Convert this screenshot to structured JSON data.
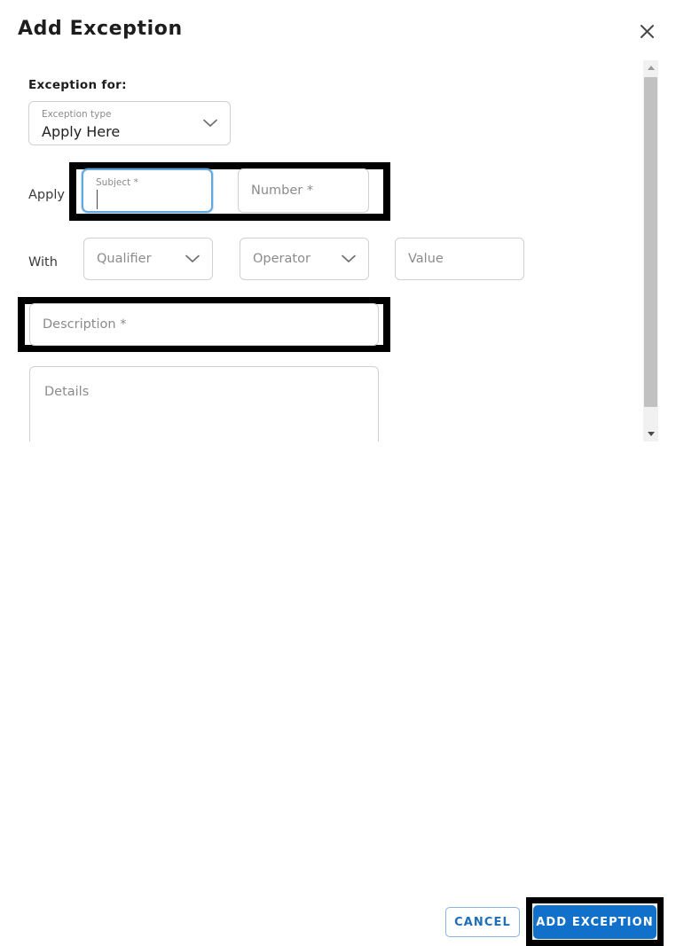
{
  "dialog": {
    "title": "Add Exception",
    "close_icon": "close-icon"
  },
  "body": {
    "section_label": "Exception for:",
    "exception_type": {
      "label": "Exception type",
      "value": "Apply Here",
      "chevron_icon": "chevron-down-icon"
    },
    "apply_row": {
      "label": "Apply",
      "subject": {
        "label": "Subject *",
        "value": "",
        "focused": true
      },
      "number": {
        "placeholder": "Number *",
        "value": ""
      }
    },
    "with_row": {
      "label": "With",
      "qualifier": {
        "placeholder": "Qualifier",
        "value": "",
        "chevron_icon": "chevron-down-icon"
      },
      "operator": {
        "placeholder": "Operator",
        "value": "",
        "chevron_icon": "chevron-down-icon"
      },
      "value_field": {
        "placeholder": "Value",
        "value": ""
      }
    },
    "description": {
      "placeholder": "Description *",
      "value": ""
    },
    "details": {
      "placeholder": "Details",
      "value": ""
    }
  },
  "scrollbar": {
    "up_icon": "scroll-up-arrow-icon",
    "down_icon": "scroll-down-arrow-icon"
  },
  "footer": {
    "cancel_label": "CANCEL",
    "submit_label": "ADD EXCEPTION"
  },
  "colors": {
    "primary_blue": "#1070CA",
    "cancel_text": "#1E6FB8",
    "cancel_border": "#88B6DD",
    "focus_blue": "#62A8E0",
    "annotation": "#000000",
    "placeholder": "#8B8B8B",
    "field_border": "#D0D0D0",
    "scrollbar_thumb": "#C1C1C1",
    "scrollbar_track": "#F1F1F1"
  }
}
